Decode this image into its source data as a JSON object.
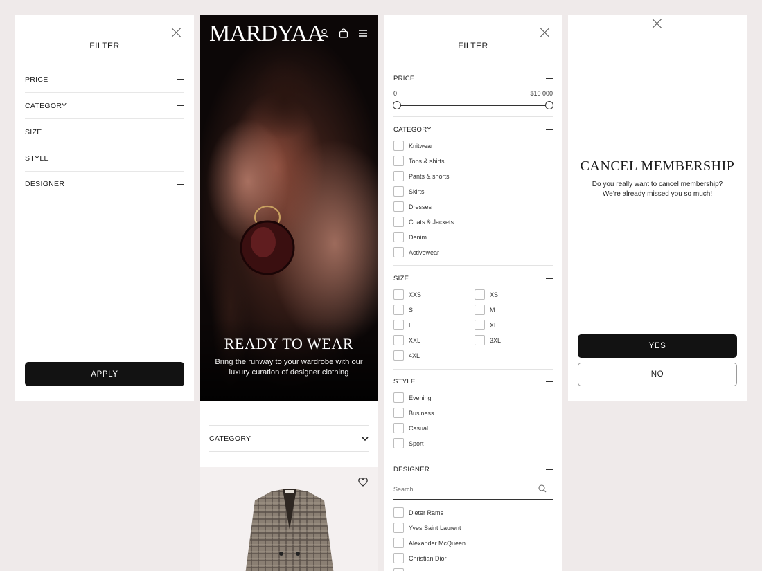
{
  "filter_collapsed": {
    "title": "FILTER",
    "sections": [
      "PRICE",
      "CATEGORY",
      "SIZE",
      "STYLE",
      "DESIGNER"
    ],
    "apply_label": "APPLY"
  },
  "mobile_home": {
    "logo": "MARDYAA",
    "hero_title": "READY TO WEAR",
    "hero_subtitle": "Bring the runway to your wardrobe with our luxury curation of designer clothing",
    "category_label": "CATEGORY"
  },
  "filter_expanded": {
    "title": "FILTER",
    "price": {
      "label": "PRICE",
      "min": "0",
      "max": "$10 000",
      "min_fraction": 0,
      "max_fraction": 1
    },
    "category": {
      "label": "CATEGORY",
      "items": [
        "Knitwear",
        "Tops & shirts",
        "Pants & shorts",
        "Skirts",
        "Dresses",
        "Coats & Jackets",
        "Denim",
        "Activewear"
      ]
    },
    "size": {
      "label": "SIZE",
      "left": [
        "XXS",
        "S",
        "L",
        "XXL",
        "4XL"
      ],
      "right": [
        "XS",
        "M",
        "XL",
        "3XL"
      ]
    },
    "style": {
      "label": "STYLE",
      "items": [
        "Evening",
        "Business",
        "Casual",
        "Sport"
      ]
    },
    "designer": {
      "label": "DESIGNER",
      "search_placeholder": "Search",
      "items": [
        "Dieter Rams",
        "Yves Saint Laurent",
        "Alexander McQueen",
        "Christian Dior"
      ]
    }
  },
  "cancel_dialog": {
    "title": "CANCEL MEMBERSHIP",
    "message_line1": "Do you really want to cancel membership?",
    "message_line2": "We’re already missed you so much!",
    "yes_label": "YES",
    "no_label": "NO"
  },
  "colors": {
    "background": "#efeaea",
    "button_dark": "#121212",
    "hero_accent": "#9d6b5c"
  }
}
